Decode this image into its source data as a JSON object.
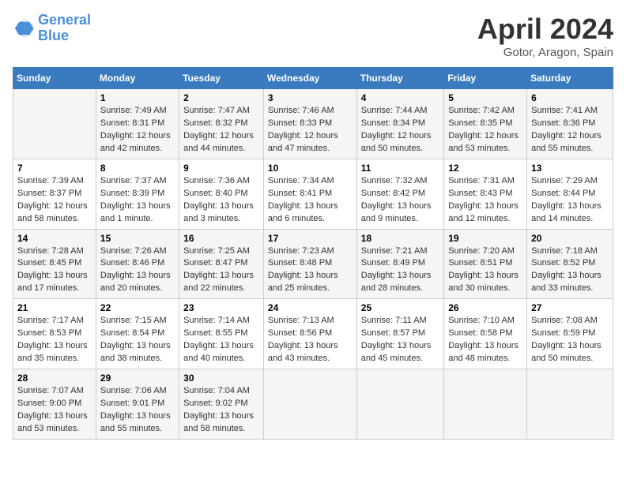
{
  "logo": {
    "line1": "General",
    "line2": "Blue"
  },
  "title": "April 2024",
  "subtitle": "Gotor, Aragon, Spain",
  "days_of_week": [
    "Sunday",
    "Monday",
    "Tuesday",
    "Wednesday",
    "Thursday",
    "Friday",
    "Saturday"
  ],
  "weeks": [
    [
      {
        "day": "",
        "sunrise": "",
        "sunset": "",
        "daylight": ""
      },
      {
        "day": "1",
        "sunrise": "Sunrise: 7:49 AM",
        "sunset": "Sunset: 8:31 PM",
        "daylight": "Daylight: 12 hours and 42 minutes."
      },
      {
        "day": "2",
        "sunrise": "Sunrise: 7:47 AM",
        "sunset": "Sunset: 8:32 PM",
        "daylight": "Daylight: 12 hours and 44 minutes."
      },
      {
        "day": "3",
        "sunrise": "Sunrise: 7:46 AM",
        "sunset": "Sunset: 8:33 PM",
        "daylight": "Daylight: 12 hours and 47 minutes."
      },
      {
        "day": "4",
        "sunrise": "Sunrise: 7:44 AM",
        "sunset": "Sunset: 8:34 PM",
        "daylight": "Daylight: 12 hours and 50 minutes."
      },
      {
        "day": "5",
        "sunrise": "Sunrise: 7:42 AM",
        "sunset": "Sunset: 8:35 PM",
        "daylight": "Daylight: 12 hours and 53 minutes."
      },
      {
        "day": "6",
        "sunrise": "Sunrise: 7:41 AM",
        "sunset": "Sunset: 8:36 PM",
        "daylight": "Daylight: 12 hours and 55 minutes."
      }
    ],
    [
      {
        "day": "7",
        "sunrise": "Sunrise: 7:39 AM",
        "sunset": "Sunset: 8:37 PM",
        "daylight": "Daylight: 12 hours and 58 minutes."
      },
      {
        "day": "8",
        "sunrise": "Sunrise: 7:37 AM",
        "sunset": "Sunset: 8:39 PM",
        "daylight": "Daylight: 13 hours and 1 minute."
      },
      {
        "day": "9",
        "sunrise": "Sunrise: 7:36 AM",
        "sunset": "Sunset: 8:40 PM",
        "daylight": "Daylight: 13 hours and 3 minutes."
      },
      {
        "day": "10",
        "sunrise": "Sunrise: 7:34 AM",
        "sunset": "Sunset: 8:41 PM",
        "daylight": "Daylight: 13 hours and 6 minutes."
      },
      {
        "day": "11",
        "sunrise": "Sunrise: 7:32 AM",
        "sunset": "Sunset: 8:42 PM",
        "daylight": "Daylight: 13 hours and 9 minutes."
      },
      {
        "day": "12",
        "sunrise": "Sunrise: 7:31 AM",
        "sunset": "Sunset: 8:43 PM",
        "daylight": "Daylight: 13 hours and 12 minutes."
      },
      {
        "day": "13",
        "sunrise": "Sunrise: 7:29 AM",
        "sunset": "Sunset: 8:44 PM",
        "daylight": "Daylight: 13 hours and 14 minutes."
      }
    ],
    [
      {
        "day": "14",
        "sunrise": "Sunrise: 7:28 AM",
        "sunset": "Sunset: 8:45 PM",
        "daylight": "Daylight: 13 hours and 17 minutes."
      },
      {
        "day": "15",
        "sunrise": "Sunrise: 7:26 AM",
        "sunset": "Sunset: 8:46 PM",
        "daylight": "Daylight: 13 hours and 20 minutes."
      },
      {
        "day": "16",
        "sunrise": "Sunrise: 7:25 AM",
        "sunset": "Sunset: 8:47 PM",
        "daylight": "Daylight: 13 hours and 22 minutes."
      },
      {
        "day": "17",
        "sunrise": "Sunrise: 7:23 AM",
        "sunset": "Sunset: 8:48 PM",
        "daylight": "Daylight: 13 hours and 25 minutes."
      },
      {
        "day": "18",
        "sunrise": "Sunrise: 7:21 AM",
        "sunset": "Sunset: 8:49 PM",
        "daylight": "Daylight: 13 hours and 28 minutes."
      },
      {
        "day": "19",
        "sunrise": "Sunrise: 7:20 AM",
        "sunset": "Sunset: 8:51 PM",
        "daylight": "Daylight: 13 hours and 30 minutes."
      },
      {
        "day": "20",
        "sunrise": "Sunrise: 7:18 AM",
        "sunset": "Sunset: 8:52 PM",
        "daylight": "Daylight: 13 hours and 33 minutes."
      }
    ],
    [
      {
        "day": "21",
        "sunrise": "Sunrise: 7:17 AM",
        "sunset": "Sunset: 8:53 PM",
        "daylight": "Daylight: 13 hours and 35 minutes."
      },
      {
        "day": "22",
        "sunrise": "Sunrise: 7:15 AM",
        "sunset": "Sunset: 8:54 PM",
        "daylight": "Daylight: 13 hours and 38 minutes."
      },
      {
        "day": "23",
        "sunrise": "Sunrise: 7:14 AM",
        "sunset": "Sunset: 8:55 PM",
        "daylight": "Daylight: 13 hours and 40 minutes."
      },
      {
        "day": "24",
        "sunrise": "Sunrise: 7:13 AM",
        "sunset": "Sunset: 8:56 PM",
        "daylight": "Daylight: 13 hours and 43 minutes."
      },
      {
        "day": "25",
        "sunrise": "Sunrise: 7:11 AM",
        "sunset": "Sunset: 8:57 PM",
        "daylight": "Daylight: 13 hours and 45 minutes."
      },
      {
        "day": "26",
        "sunrise": "Sunrise: 7:10 AM",
        "sunset": "Sunset: 8:58 PM",
        "daylight": "Daylight: 13 hours and 48 minutes."
      },
      {
        "day": "27",
        "sunrise": "Sunrise: 7:08 AM",
        "sunset": "Sunset: 8:59 PM",
        "daylight": "Daylight: 13 hours and 50 minutes."
      }
    ],
    [
      {
        "day": "28",
        "sunrise": "Sunrise: 7:07 AM",
        "sunset": "Sunset: 9:00 PM",
        "daylight": "Daylight: 13 hours and 53 minutes."
      },
      {
        "day": "29",
        "sunrise": "Sunrise: 7:06 AM",
        "sunset": "Sunset: 9:01 PM",
        "daylight": "Daylight: 13 hours and 55 minutes."
      },
      {
        "day": "30",
        "sunrise": "Sunrise: 7:04 AM",
        "sunset": "Sunset: 9:02 PM",
        "daylight": "Daylight: 13 hours and 58 minutes."
      },
      {
        "day": "",
        "sunrise": "",
        "sunset": "",
        "daylight": ""
      },
      {
        "day": "",
        "sunrise": "",
        "sunset": "",
        "daylight": ""
      },
      {
        "day": "",
        "sunrise": "",
        "sunset": "",
        "daylight": ""
      },
      {
        "day": "",
        "sunrise": "",
        "sunset": "",
        "daylight": ""
      }
    ]
  ]
}
